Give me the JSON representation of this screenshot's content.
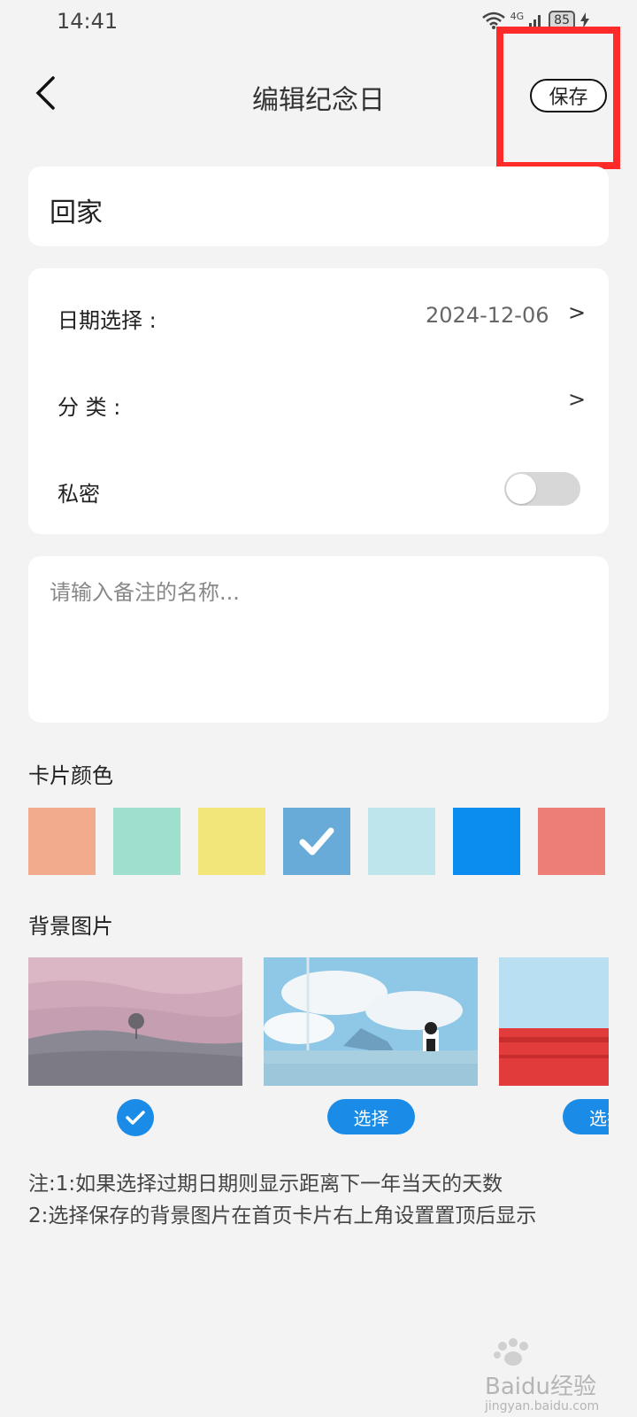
{
  "status_bar": {
    "time": "14:41",
    "network": "4G",
    "battery": "85"
  },
  "header": {
    "title": "编辑纪念日",
    "save_label": "保存"
  },
  "name": {
    "value": "回家"
  },
  "settings": {
    "date_label": "日期选择 :",
    "date_value": "2024-12-06",
    "category_label": "分 类 :",
    "private_label": "私密",
    "private_on": false,
    "chevron": ">"
  },
  "note": {
    "placeholder": "请输入备注的名称..."
  },
  "card_color": {
    "title": "卡片颜色",
    "swatches": [
      "#f2ab8d",
      "#9ee0cd",
      "#f2e67a",
      "#69abd8",
      "#bfe5ec",
      "#0b8df0",
      "#ec7e75"
    ],
    "selected_index": 3
  },
  "background": {
    "title": "背景图片",
    "select_label": "选择",
    "selected_index": 0
  },
  "footnote": {
    "line1": "注:1:如果选择过期日期则显示距离下一年当天的天数",
    "line2": "2:选择保存的背景图片在首页卡片右上角设置置顶后显示"
  },
  "watermark": {
    "text": "Baidu经验",
    "url": "jingyan.baidu.com"
  }
}
